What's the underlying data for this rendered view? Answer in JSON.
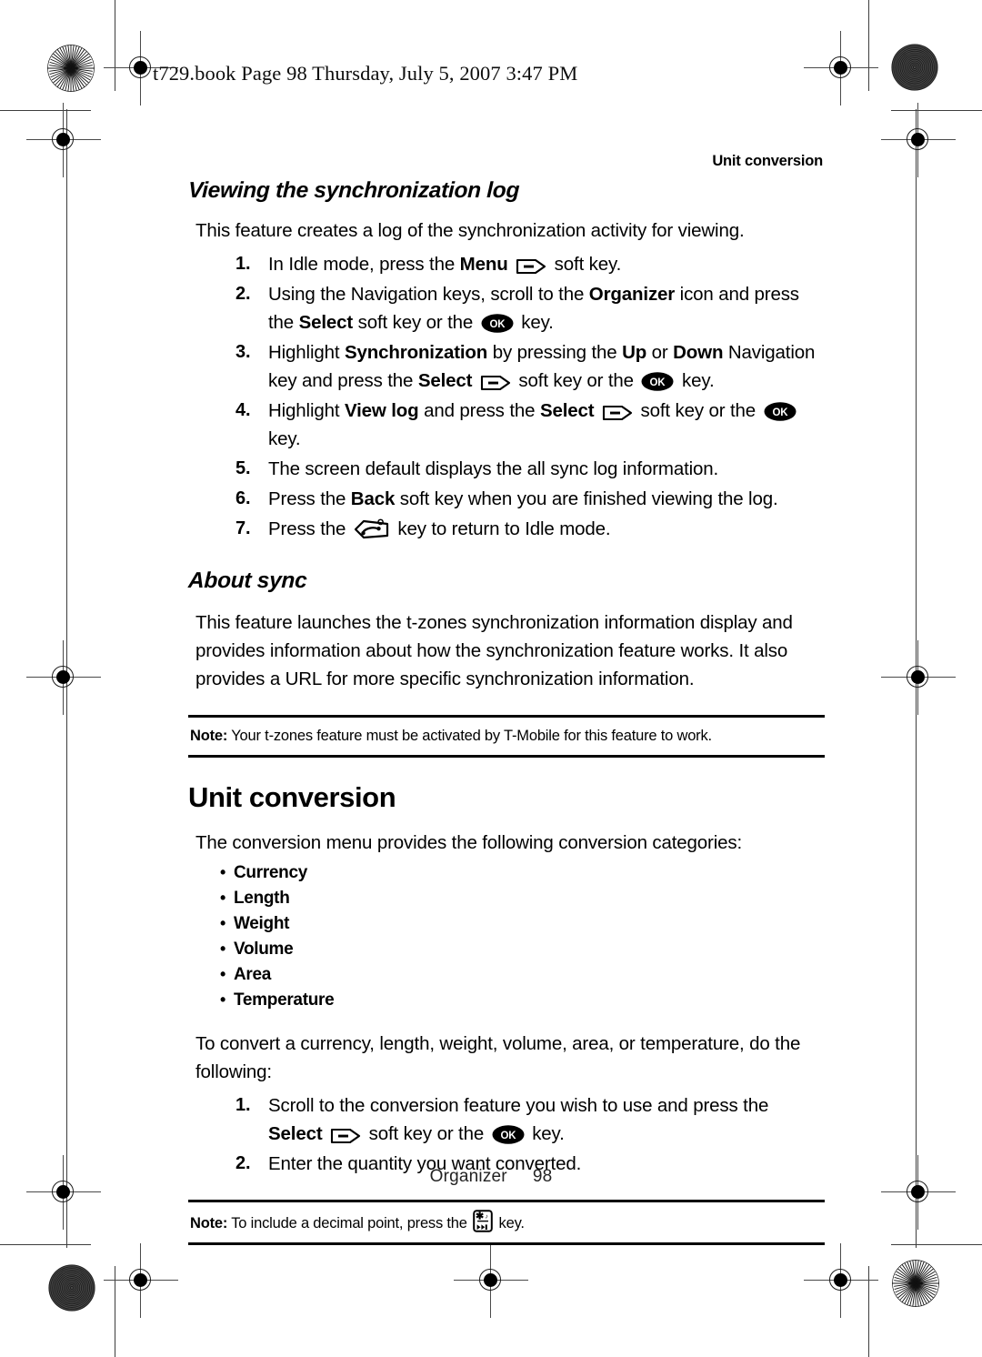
{
  "printers_mark_header": "t729.book  Page 98  Thursday, July 5, 2007  3:47 PM",
  "running_head": "Unit conversion",
  "sections": {
    "viewing_log": {
      "heading": "Viewing the synchronization log",
      "intro": "This feature creates a log of the synchronization activity for viewing.",
      "steps": [
        {
          "num": "1.",
          "parts": [
            {
              "t": "text",
              "v": "In Idle mode, press the "
            },
            {
              "t": "bold",
              "v": "Menu"
            },
            {
              "t": "text",
              "v": " "
            },
            {
              "t": "icon",
              "v": "soft-key-icon"
            },
            {
              "t": "text",
              "v": " soft key."
            }
          ]
        },
        {
          "num": "2.",
          "parts": [
            {
              "t": "text",
              "v": "Using the Navigation keys, scroll to the "
            },
            {
              "t": "bold",
              "v": "Organizer"
            },
            {
              "t": "text",
              "v": " icon and press the "
            },
            {
              "t": "bold",
              "v": "Select"
            },
            {
              "t": "text",
              "v": " soft key or the "
            },
            {
              "t": "icon",
              "v": "ok-key-icon"
            },
            {
              "t": "text",
              "v": " key."
            }
          ]
        },
        {
          "num": "3.",
          "parts": [
            {
              "t": "text",
              "v": "Highlight "
            },
            {
              "t": "bold",
              "v": "Synchronization"
            },
            {
              "t": "text",
              "v": " by pressing the "
            },
            {
              "t": "bold",
              "v": "Up"
            },
            {
              "t": "text",
              "v": " or "
            },
            {
              "t": "bold",
              "v": "Down"
            },
            {
              "t": "text",
              "v": " Navigation key and press the "
            },
            {
              "t": "bold",
              "v": "Select"
            },
            {
              "t": "text",
              "v": " "
            },
            {
              "t": "icon",
              "v": "soft-key-icon"
            },
            {
              "t": "text",
              "v": " soft key or the "
            },
            {
              "t": "icon",
              "v": "ok-key-icon"
            },
            {
              "t": "text",
              "v": " key."
            }
          ]
        },
        {
          "num": "4.",
          "parts": [
            {
              "t": "text",
              "v": "Highlight "
            },
            {
              "t": "bold",
              "v": "View log"
            },
            {
              "t": "text",
              "v": " and press the "
            },
            {
              "t": "bold",
              "v": "Select"
            },
            {
              "t": "text",
              "v": " "
            },
            {
              "t": "icon",
              "v": "soft-key-icon"
            },
            {
              "t": "text",
              "v": " soft key or the "
            },
            {
              "t": "icon",
              "v": "ok-key-icon"
            },
            {
              "t": "text",
              "v": " key."
            }
          ]
        },
        {
          "num": "5.",
          "parts": [
            {
              "t": "text",
              "v": "The screen default displays the all sync log information."
            }
          ]
        },
        {
          "num": "6.",
          "parts": [
            {
              "t": "text",
              "v": "Press the "
            },
            {
              "t": "bold",
              "v": "Back"
            },
            {
              "t": "text",
              "v": " soft key when you are finished viewing the log."
            }
          ]
        },
        {
          "num": "7.",
          "parts": [
            {
              "t": "text",
              "v": "Press the "
            },
            {
              "t": "icon",
              "v": "end-call-key-icon"
            },
            {
              "t": "text",
              "v": " key to return to Idle mode."
            }
          ]
        }
      ]
    },
    "about_sync": {
      "heading": "About sync",
      "body": "This feature launches the t-zones synchronization information display and provides information about how the synchronization feature works. It also provides a URL for more specific synchronization information.",
      "note": {
        "label": "Note:",
        "text": " Your t-zones feature must be activated by T-Mobile for this feature to work."
      }
    },
    "unit_conversion": {
      "heading": "Unit conversion",
      "intro": "The conversion menu provides the following conversion categories:",
      "categories": [
        "Currency",
        "Length",
        "Weight",
        "Volume",
        "Area",
        "Temperature"
      ],
      "lead_in": "To convert a currency, length, weight, volume, area, or temperature, do the following:",
      "steps": [
        {
          "num": "1.",
          "parts": [
            {
              "t": "text",
              "v": "Scroll to the conversion feature you wish to use and press the "
            },
            {
              "t": "bold",
              "v": "Select"
            },
            {
              "t": "text",
              "v": " "
            },
            {
              "t": "icon",
              "v": "soft-key-icon"
            },
            {
              "t": "text",
              "v": " soft key or the "
            },
            {
              "t": "icon",
              "v": "ok-key-icon"
            },
            {
              "t": "text",
              "v": " key."
            }
          ]
        },
        {
          "num": "2.",
          "parts": [
            {
              "t": "text",
              "v": "Enter the quantity you want converted."
            }
          ]
        }
      ],
      "note": {
        "label": "Note:",
        "text_before": " To include a decimal point, press the ",
        "icon": "star-key-icon",
        "text_after": " key."
      }
    }
  },
  "footer": {
    "chapter": "Organizer",
    "page_number": "98"
  },
  "colors": {
    "text": "#000000",
    "mark": "#3d3d3d",
    "key_fill": "#000000"
  }
}
